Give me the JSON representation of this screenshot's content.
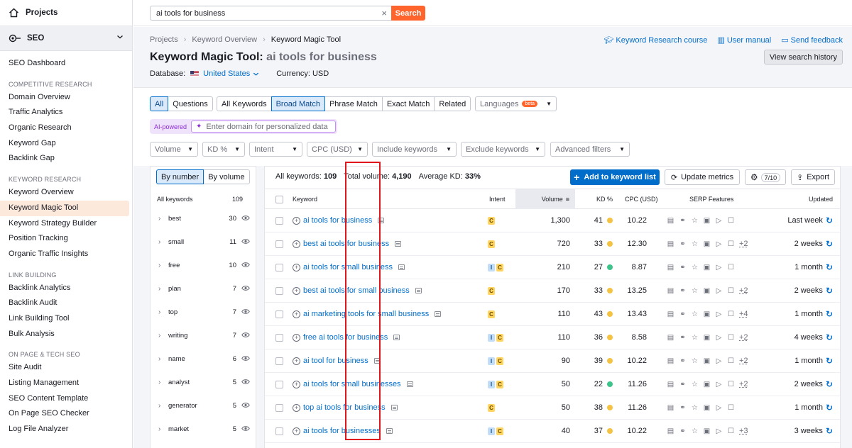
{
  "sidebar": {
    "projects_label": "Projects",
    "seo_label": "SEO",
    "items": [
      {
        "type": "item",
        "label": "SEO Dashboard"
      },
      {
        "type": "head",
        "label": "COMPETITIVE RESEARCH"
      },
      {
        "type": "item",
        "label": "Domain Overview"
      },
      {
        "type": "item",
        "label": "Traffic Analytics"
      },
      {
        "type": "item",
        "label": "Organic Research"
      },
      {
        "type": "item",
        "label": "Keyword Gap"
      },
      {
        "type": "item",
        "label": "Backlink Gap"
      },
      {
        "type": "head",
        "label": "KEYWORD RESEARCH"
      },
      {
        "type": "item",
        "label": "Keyword Overview"
      },
      {
        "type": "item",
        "label": "Keyword Magic Tool",
        "active": true
      },
      {
        "type": "item",
        "label": "Keyword Strategy Builder"
      },
      {
        "type": "item",
        "label": "Position Tracking"
      },
      {
        "type": "item",
        "label": "Organic Traffic Insights"
      },
      {
        "type": "head",
        "label": "LINK BUILDING"
      },
      {
        "type": "item",
        "label": "Backlink Analytics"
      },
      {
        "type": "item",
        "label": "Backlink Audit"
      },
      {
        "type": "item",
        "label": "Link Building Tool"
      },
      {
        "type": "item",
        "label": "Bulk Analysis"
      },
      {
        "type": "head",
        "label": "ON PAGE & TECH SEO"
      },
      {
        "type": "item",
        "label": "Site Audit"
      },
      {
        "type": "item",
        "label": "Listing Management"
      },
      {
        "type": "item",
        "label": "SEO Content Template"
      },
      {
        "type": "item",
        "label": "On Page SEO Checker"
      },
      {
        "type": "item",
        "label": "Log File Analyzer"
      }
    ]
  },
  "search": {
    "value": "ai tools for business",
    "button": "Search"
  },
  "breadcrumb": [
    "Projects",
    "Keyword Overview",
    "Keyword Magic Tool"
  ],
  "title": {
    "prefix": "Keyword Magic Tool:",
    "query": "ai tools for business"
  },
  "database": {
    "label": "Database:",
    "value": "United States",
    "currency": "Currency: USD"
  },
  "header_links": {
    "course": "Keyword Research course",
    "manual": "User manual",
    "feedback": "Send feedback",
    "history": "View search history"
  },
  "filters": {
    "type_tabs": [
      "All",
      "Questions"
    ],
    "match_tabs": [
      "All Keywords",
      "Broad Match",
      "Phrase Match",
      "Exact Match",
      "Related"
    ],
    "languages": "Languages",
    "beta": "beta",
    "ai_label": "AI-powered",
    "ai_placeholder": "Enter domain for personalized data",
    "dropdowns": [
      "Volume",
      "KD %",
      "Intent",
      "CPC (USD)",
      "Include keywords",
      "Exclude keywords",
      "Advanced filters"
    ]
  },
  "groups": {
    "toggle": [
      "By number",
      "By volume"
    ],
    "head_label": "All keywords",
    "head_count": "109",
    "items": [
      {
        "label": "best",
        "count": "30"
      },
      {
        "label": "small",
        "count": "11"
      },
      {
        "label": "free",
        "count": "10"
      },
      {
        "label": "plan",
        "count": "7"
      },
      {
        "label": "top",
        "count": "7"
      },
      {
        "label": "writing",
        "count": "7"
      },
      {
        "label": "name",
        "count": "6"
      },
      {
        "label": "analyst",
        "count": "5"
      },
      {
        "label": "generator",
        "count": "5"
      },
      {
        "label": "market",
        "count": "5"
      }
    ]
  },
  "summary": {
    "all_label": "All keywords:",
    "all_value": "109",
    "volume_label": "Total volume:",
    "volume_value": "4,190",
    "kd_label": "Average KD:",
    "kd_value": "33%"
  },
  "actions": {
    "add": "Add to keyword list",
    "update": "Update metrics",
    "config": "7/10",
    "export": "Export"
  },
  "columns": {
    "keyword": "Keyword",
    "intent": "Intent",
    "volume": "Volume",
    "kd": "KD %",
    "cpc": "CPC (USD)",
    "serp": "SERP Features",
    "updated": "Updated"
  },
  "colors": {
    "kd_yellow": "#f5c342",
    "kd_green": "#3cc48a",
    "accent": "#006dca",
    "search": "#ff642d",
    "highlight": "#e0161e"
  },
  "rows": [
    {
      "keyword": "ai tools for business",
      "intent": [
        "C"
      ],
      "volume": "1,300",
      "kd": "41",
      "kd_color": "yellow",
      "cpc": "10.22",
      "more": "",
      "updated": "Last week"
    },
    {
      "keyword": "best ai tools for business",
      "intent": [
        "C"
      ],
      "volume": "720",
      "kd": "33",
      "kd_color": "yellow",
      "cpc": "12.30",
      "more": "+2",
      "updated": "2 weeks"
    },
    {
      "keyword": "ai tools for small business",
      "intent": [
        "I",
        "C"
      ],
      "volume": "210",
      "kd": "27",
      "kd_color": "green",
      "cpc": "8.87",
      "more": "",
      "updated": "1 month"
    },
    {
      "keyword": "best ai tools for small business",
      "intent": [
        "C"
      ],
      "volume": "170",
      "kd": "33",
      "kd_color": "yellow",
      "cpc": "13.25",
      "more": "+2",
      "updated": "2 weeks"
    },
    {
      "keyword": "ai marketing tools for small business",
      "intent": [
        "C"
      ],
      "volume": "110",
      "kd": "43",
      "kd_color": "yellow",
      "cpc": "13.43",
      "more": "+4",
      "updated": "1 month"
    },
    {
      "keyword": "free ai tools for business",
      "intent": [
        "I",
        "C"
      ],
      "volume": "110",
      "kd": "36",
      "kd_color": "yellow",
      "cpc": "8.58",
      "more": "+2",
      "updated": "4 weeks"
    },
    {
      "keyword": "ai tool for business",
      "intent": [
        "I",
        "C"
      ],
      "volume": "90",
      "kd": "39",
      "kd_color": "yellow",
      "cpc": "10.22",
      "more": "+2",
      "updated": "1 month"
    },
    {
      "keyword": "ai tools for small businesses",
      "intent": [
        "I",
        "C"
      ],
      "volume": "50",
      "kd": "22",
      "kd_color": "green",
      "cpc": "11.26",
      "more": "+2",
      "updated": "2 weeks"
    },
    {
      "keyword": "top ai tools for business",
      "intent": [
        "C"
      ],
      "volume": "50",
      "kd": "38",
      "kd_color": "yellow",
      "cpc": "11.26",
      "more": "",
      "updated": "1 month"
    },
    {
      "keyword": "ai tools for businesses",
      "intent": [
        "I",
        "C"
      ],
      "volume": "40",
      "kd": "37",
      "kd_color": "yellow",
      "cpc": "10.22",
      "more": "+3",
      "updated": "3 weeks"
    }
  ]
}
